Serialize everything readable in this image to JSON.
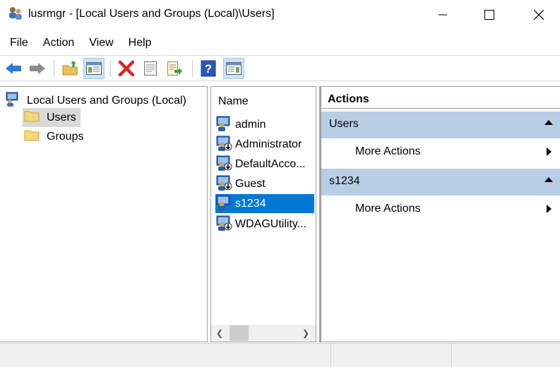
{
  "window": {
    "title": "lusrmgr - [Local Users and Groups (Local)\\Users]"
  },
  "menu": [
    "File",
    "Action",
    "View",
    "Help"
  ],
  "toolbar": {
    "buttons": [
      "back-icon",
      "forward-icon",
      "up-folder-icon",
      "show-hide-console-tree-icon",
      "delete-icon",
      "properties-icon",
      "export-list-icon",
      "help-icon",
      "show-hide-action-pane-icon"
    ]
  },
  "tree": {
    "root": "Local Users and Groups (Local)",
    "nodes": [
      {
        "label": "Users",
        "selected": true
      },
      {
        "label": "Groups",
        "selected": false
      }
    ]
  },
  "list": {
    "header": "Name",
    "items": [
      {
        "label": "admin",
        "selected": false
      },
      {
        "label": "Administrator",
        "selected": false
      },
      {
        "label": "DefaultAcco...",
        "selected": false
      },
      {
        "label": "Guest",
        "selected": false
      },
      {
        "label": "s1234",
        "selected": true
      },
      {
        "label": "WDAGUtility...",
        "selected": false
      }
    ]
  },
  "actions": {
    "title": "Actions",
    "groups": [
      {
        "label": "Users",
        "items": [
          "More Actions"
        ]
      },
      {
        "label": "s1234",
        "items": [
          "More Actions"
        ]
      }
    ]
  },
  "colors": {
    "selection": "#0078d7",
    "action_group_bg": "#b9cde5"
  }
}
